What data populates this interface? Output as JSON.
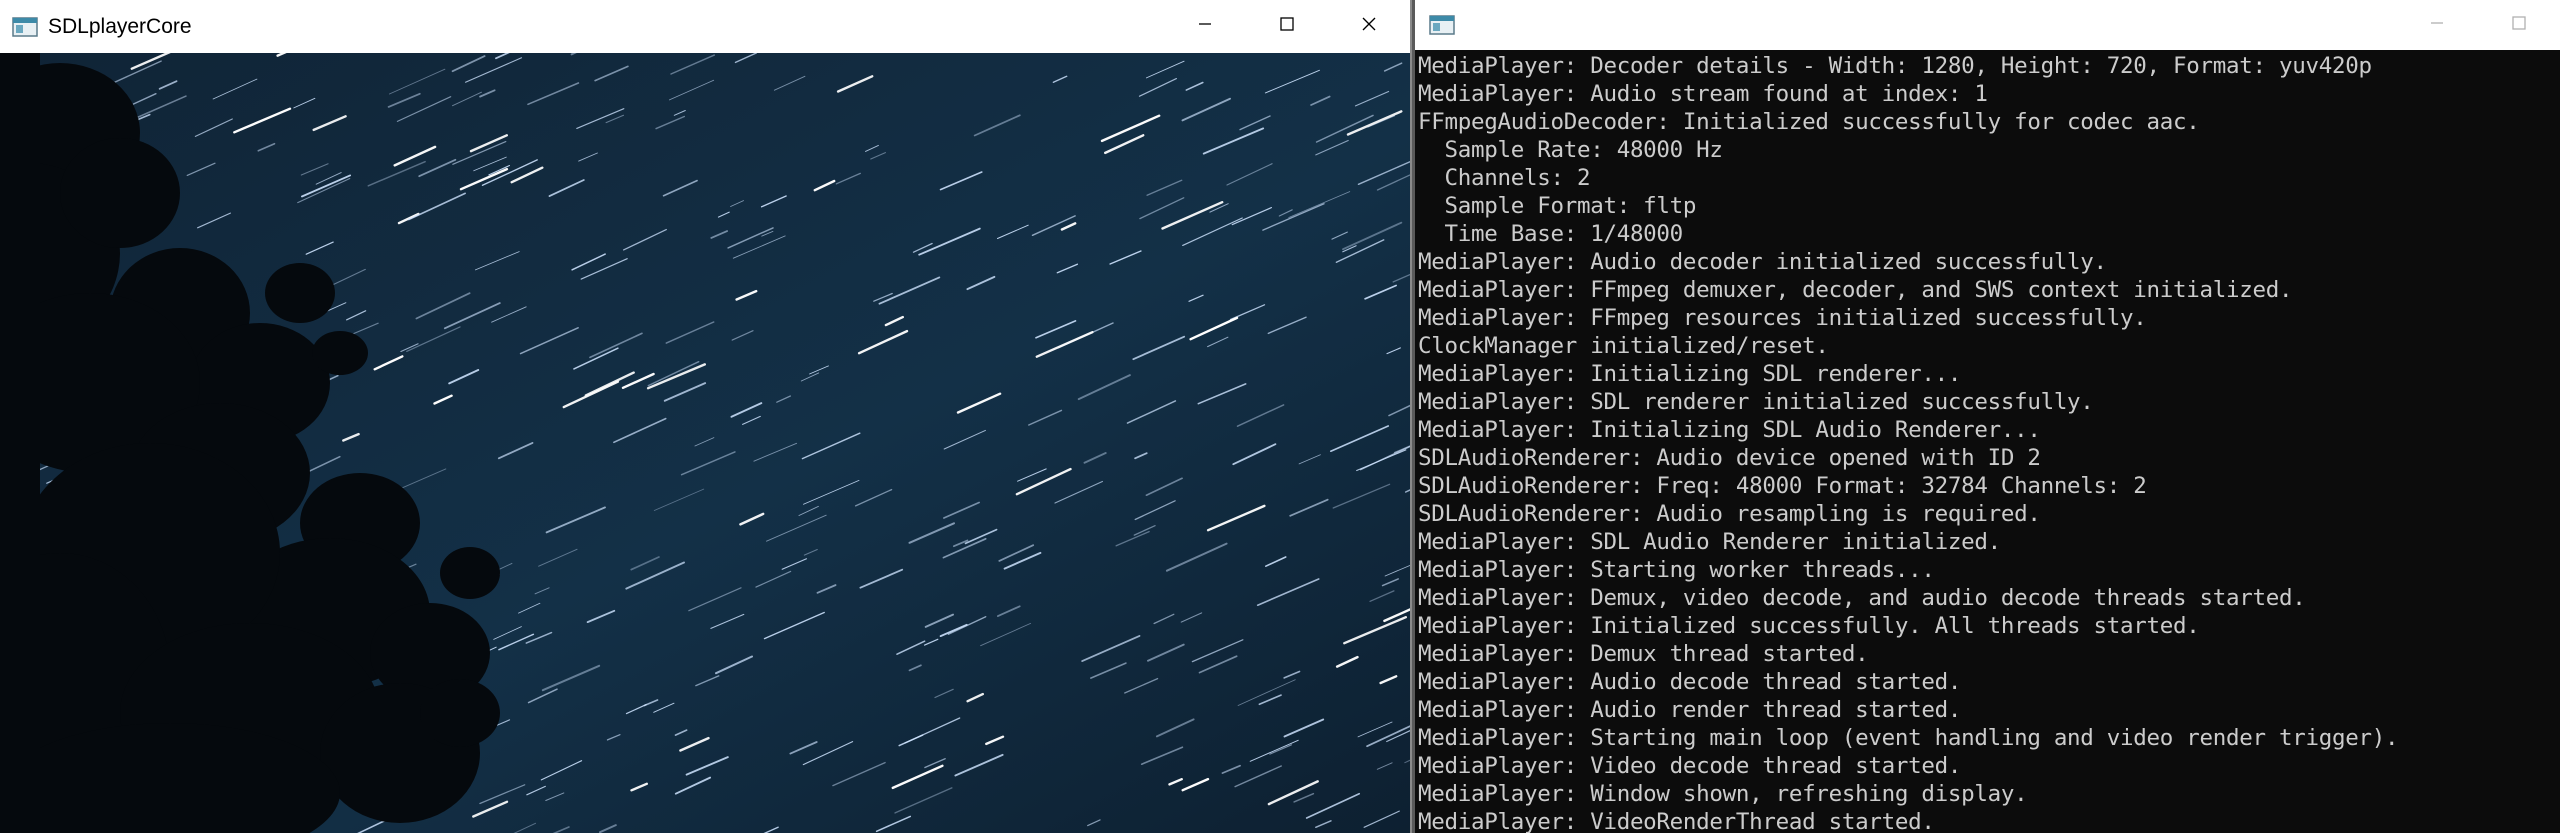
{
  "player_window": {
    "title": "SDLplayerCore",
    "icon": "app-window-icon",
    "caption_buttons": [
      "minimize-icon",
      "maximize-icon",
      "close-icon"
    ]
  },
  "console_window": {
    "title": "",
    "icon": "console-window-icon",
    "caption_buttons": [
      "minimize-icon",
      "maximize-icon"
    ],
    "lines": [
      "MediaPlayer: Decoder details - Width: 1280, Height: 720, Format: yuv420p",
      "MediaPlayer: Audio stream found at index: 1",
      "FFmpegAudioDecoder: Initialized successfully for codec aac.",
      "  Sample Rate: 48000 Hz",
      "  Channels: 2",
      "  Sample Format: fltp",
      "  Time Base: 1/48000",
      "MediaPlayer: Audio decoder initialized successfully.",
      "MediaPlayer: FFmpeg demuxer, decoder, and SWS context initialized.",
      "MediaPlayer: FFmpeg resources initialized successfully.",
      "ClockManager initialized/reset.",
      "MediaPlayer: Initializing SDL renderer...",
      "MediaPlayer: SDL renderer initialized successfully.",
      "MediaPlayer: Initializing SDL Audio Renderer...",
      "SDLAudioRenderer: Audio device opened with ID 2",
      "SDLAudioRenderer: Freq: 48000 Format: 32784 Channels: 2",
      "SDLAudioRenderer: Audio resampling is required.",
      "MediaPlayer: SDL Audio Renderer initialized.",
      "MediaPlayer: Starting worker threads...",
      "MediaPlayer: Demux, video decode, and audio decode threads started.",
      "MediaPlayer: Initialized successfully. All threads started.",
      "MediaPlayer: Demux thread started.",
      "MediaPlayer: Audio decode thread started.",
      "MediaPlayer: Audio render thread started.",
      "MediaPlayer: Starting main loop (event handling and video render trigger).",
      "MediaPlayer: Video decode thread started.",
      "MediaPlayer: Window shown, refreshing display.",
      "MediaPlayer: VideoRenderThread started."
    ]
  },
  "colors": {
    "console_bg": "#0c0c0c",
    "console_text": "#cccccc",
    "sky": "#0f2233",
    "star": "#cfe4ff"
  }
}
